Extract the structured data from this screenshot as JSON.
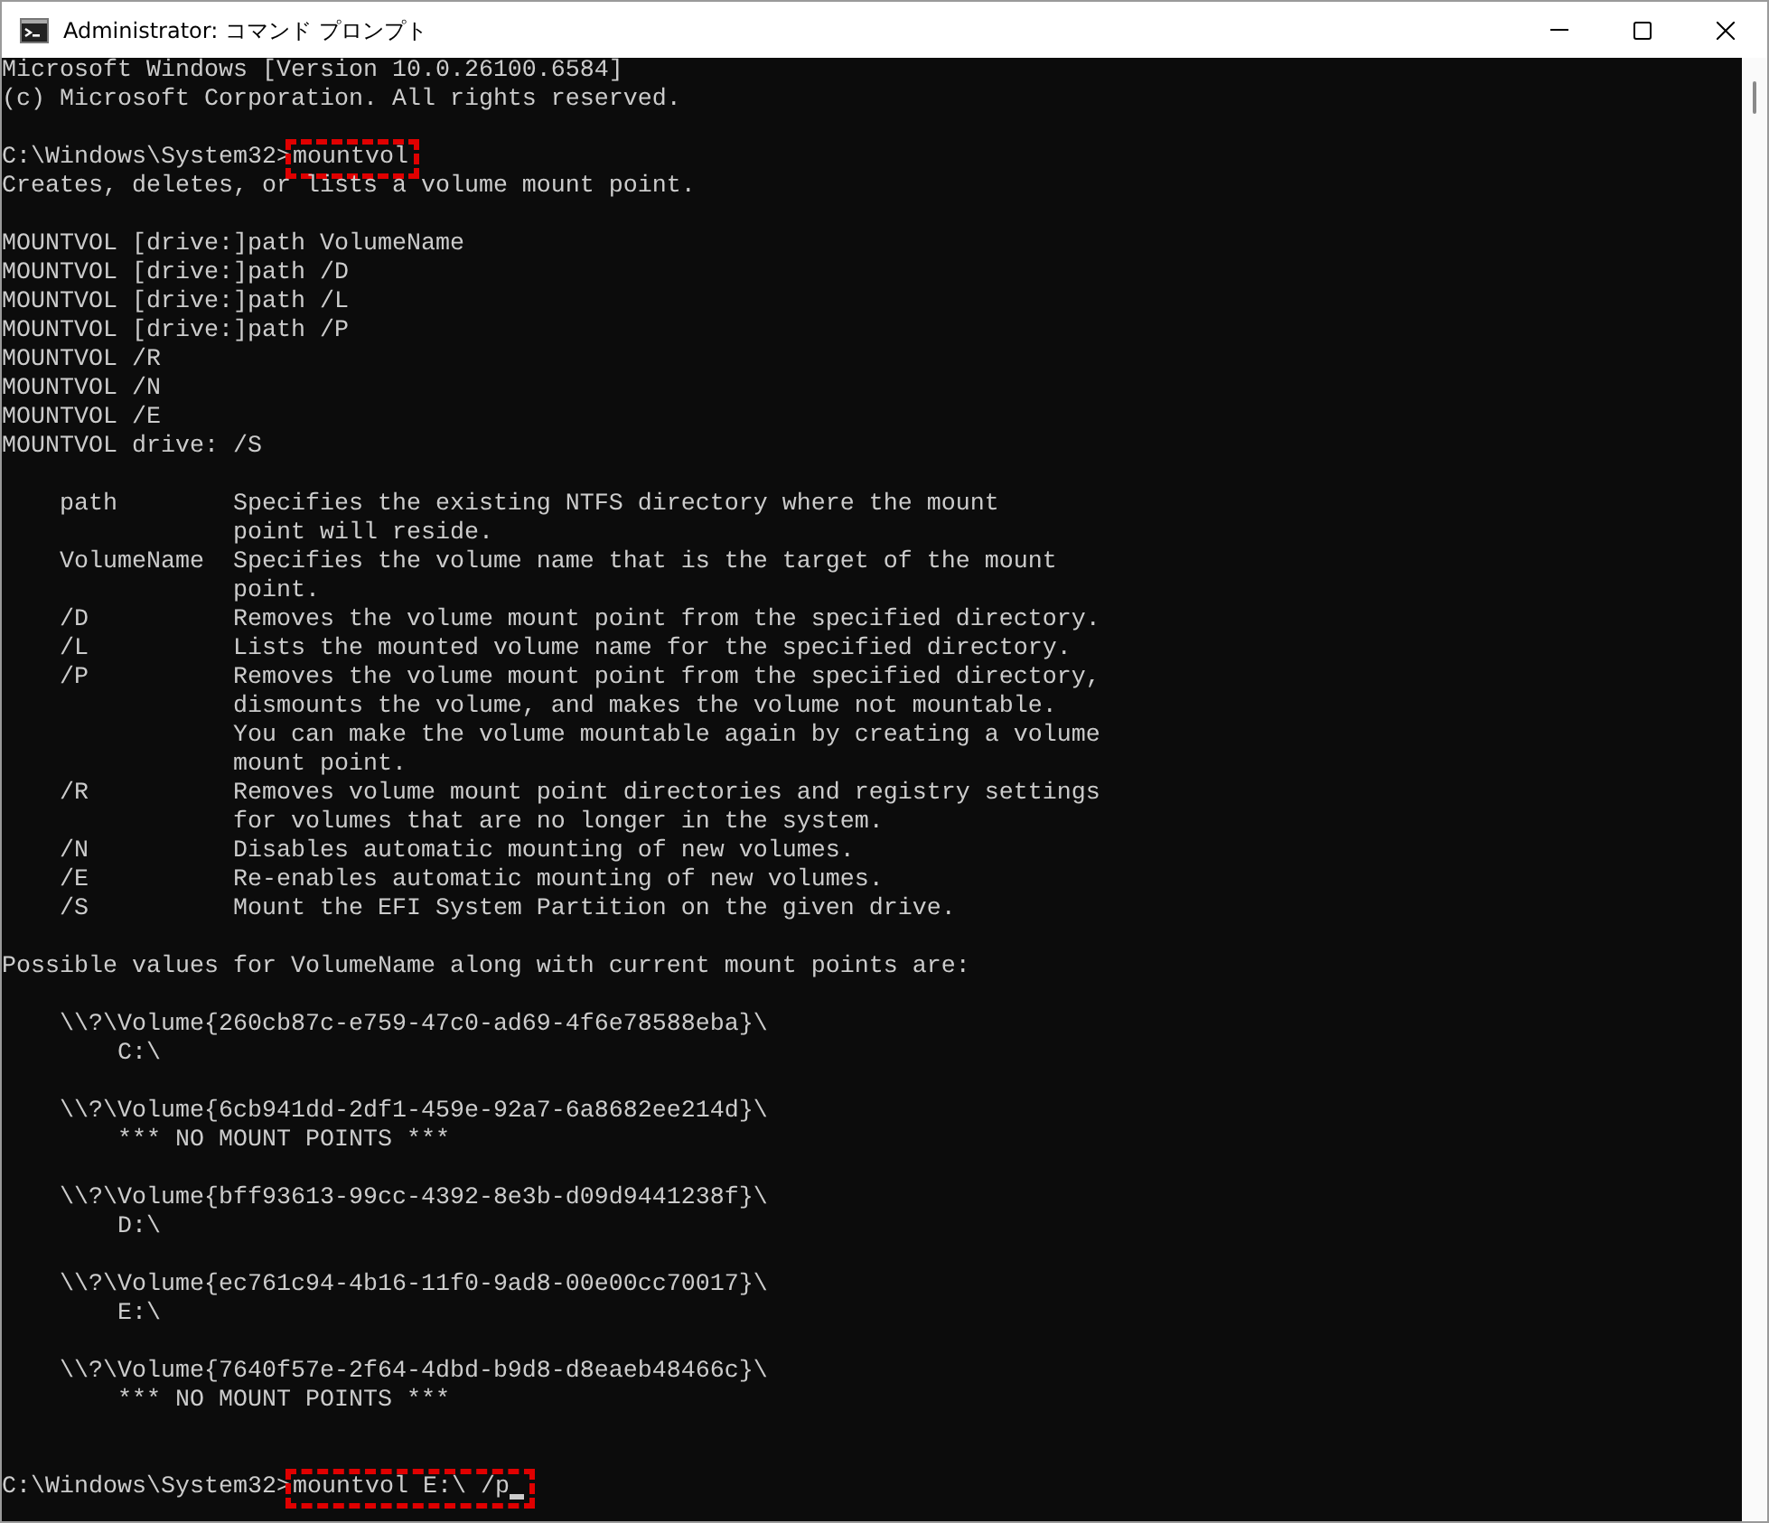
{
  "window": {
    "title": "Administrator: コマンド プロンプト",
    "controls": [
      {
        "kind": "minimize"
      },
      {
        "kind": "maximize"
      },
      {
        "kind": "close"
      }
    ]
  },
  "console": {
    "lines": [
      {
        "kind": "text",
        "text": "Microsoft Windows [Version 10.0.26100.6584]"
      },
      {
        "kind": "text",
        "text": "(c) Microsoft Corporation. All rights reserved."
      },
      {
        "kind": "blank"
      },
      {
        "kind": "prompt",
        "prompt": "C:\\Windows\\System32>",
        "command": "mountvol",
        "highlighted": true,
        "cursor": false
      },
      {
        "kind": "text",
        "text": "Creates, deletes, or lists a volume mount point."
      },
      {
        "kind": "blank"
      },
      {
        "kind": "text",
        "text": "MOUNTVOL [drive:]path VolumeName"
      },
      {
        "kind": "text",
        "text": "MOUNTVOL [drive:]path /D"
      },
      {
        "kind": "text",
        "text": "MOUNTVOL [drive:]path /L"
      },
      {
        "kind": "text",
        "text": "MOUNTVOL [drive:]path /P"
      },
      {
        "kind": "text",
        "text": "MOUNTVOL /R"
      },
      {
        "kind": "text",
        "text": "MOUNTVOL /N"
      },
      {
        "kind": "text",
        "text": "MOUNTVOL /E"
      },
      {
        "kind": "text",
        "text": "MOUNTVOL drive: /S"
      },
      {
        "kind": "blank"
      },
      {
        "kind": "text",
        "text": "    path        Specifies the existing NTFS directory where the mount"
      },
      {
        "kind": "text",
        "text": "                point will reside."
      },
      {
        "kind": "text",
        "text": "    VolumeName  Specifies the volume name that is the target of the mount"
      },
      {
        "kind": "text",
        "text": "                point."
      },
      {
        "kind": "text",
        "text": "    /D          Removes the volume mount point from the specified directory."
      },
      {
        "kind": "text",
        "text": "    /L          Lists the mounted volume name for the specified directory."
      },
      {
        "kind": "text",
        "text": "    /P          Removes the volume mount point from the specified directory,"
      },
      {
        "kind": "text",
        "text": "                dismounts the volume, and makes the volume not mountable."
      },
      {
        "kind": "text",
        "text": "                You can make the volume mountable again by creating a volume"
      },
      {
        "kind": "text",
        "text": "                mount point."
      },
      {
        "kind": "text",
        "text": "    /R          Removes volume mount point directories and registry settings"
      },
      {
        "kind": "text",
        "text": "                for volumes that are no longer in the system."
      },
      {
        "kind": "text",
        "text": "    /N          Disables automatic mounting of new volumes."
      },
      {
        "kind": "text",
        "text": "    /E          Re-enables automatic mounting of new volumes."
      },
      {
        "kind": "text",
        "text": "    /S          Mount the EFI System Partition on the given drive."
      },
      {
        "kind": "blank"
      },
      {
        "kind": "text",
        "text": "Possible values for VolumeName along with current mount points are:"
      },
      {
        "kind": "blank"
      },
      {
        "kind": "text",
        "text": "    \\\\?\\Volume{260cb87c-e759-47c0-ad69-4f6e78588eba}\\"
      },
      {
        "kind": "text",
        "text": "        C:\\"
      },
      {
        "kind": "blank"
      },
      {
        "kind": "text",
        "text": "    \\\\?\\Volume{6cb941dd-2df1-459e-92a7-6a8682ee214d}\\"
      },
      {
        "kind": "text",
        "text": "        *** NO MOUNT POINTS ***"
      },
      {
        "kind": "blank"
      },
      {
        "kind": "text",
        "text": "    \\\\?\\Volume{bff93613-99cc-4392-8e3b-d09d9441238f}\\"
      },
      {
        "kind": "text",
        "text": "        D:\\"
      },
      {
        "kind": "blank"
      },
      {
        "kind": "text",
        "text": "    \\\\?\\Volume{ec761c94-4b16-11f0-9ad8-00e00cc70017}\\"
      },
      {
        "kind": "text",
        "text": "        E:\\"
      },
      {
        "kind": "blank"
      },
      {
        "kind": "text",
        "text": "    \\\\?\\Volume{7640f57e-2f64-4dbd-b9d8-d8eaeb48466c}\\"
      },
      {
        "kind": "text",
        "text": "        *** NO MOUNT POINTS ***"
      },
      {
        "kind": "blank"
      },
      {
        "kind": "blank"
      },
      {
        "kind": "prompt",
        "prompt": "C:\\Windows\\System32>",
        "command": "mountvol E:\\ /p",
        "highlighted": true,
        "cursor": true
      }
    ]
  }
}
